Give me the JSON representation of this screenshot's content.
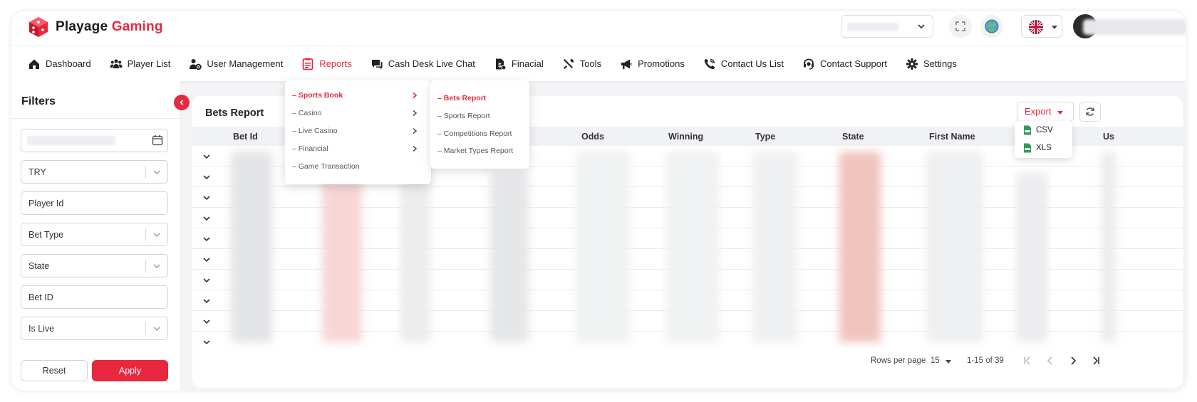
{
  "brand": {
    "word1": "Playage",
    "word2": "Gaming",
    "accent": "#e8283e"
  },
  "nav": [
    {
      "label": "Dashboard",
      "icon": "home-icon"
    },
    {
      "label": "Player List",
      "icon": "users-icon"
    },
    {
      "label": "User Management",
      "icon": "user-gear-icon"
    },
    {
      "label": "Reports",
      "icon": "reports-icon",
      "active": true
    },
    {
      "label": "Cash Desk Live Chat",
      "icon": "chat-icon"
    },
    {
      "label": "Finacial",
      "icon": "money-file-icon"
    },
    {
      "label": "Tools",
      "icon": "tools-icon"
    },
    {
      "label": "Promotions",
      "icon": "megaphone-icon"
    },
    {
      "label": "Contact Us List",
      "icon": "phone-icon"
    },
    {
      "label": "Contact Support",
      "icon": "headset-icon"
    },
    {
      "label": "Settings",
      "icon": "gear-icon"
    }
  ],
  "reports_menu": {
    "items": [
      "Sports Book",
      "Casino",
      "Live Casino",
      "Financial",
      "Game Transaction"
    ],
    "sub_items": [
      "Bets Report",
      "Sports Report",
      "Competitions Report",
      "Market Types Report"
    ]
  },
  "filters": {
    "title": "Filters",
    "currency": "TRY",
    "player_id_placeholder": "Player Id",
    "bet_type": "Bet Type",
    "state": "State",
    "bet_id_placeholder": "Bet ID",
    "is_live": "Is Live",
    "reset": "Reset",
    "apply": "Apply"
  },
  "report": {
    "title": "Bets Report",
    "export_label": "Export",
    "export_options": [
      "CSV",
      "XLS"
    ],
    "columns": [
      "Bet Id",
      "Odds",
      "Winning",
      "Type",
      "State",
      "First Name",
      "Us"
    ],
    "row_count": 10
  },
  "pagination": {
    "rows_per_page_label": "Rows per page",
    "rows_per_page": "15",
    "range": "1-15 of 39"
  }
}
